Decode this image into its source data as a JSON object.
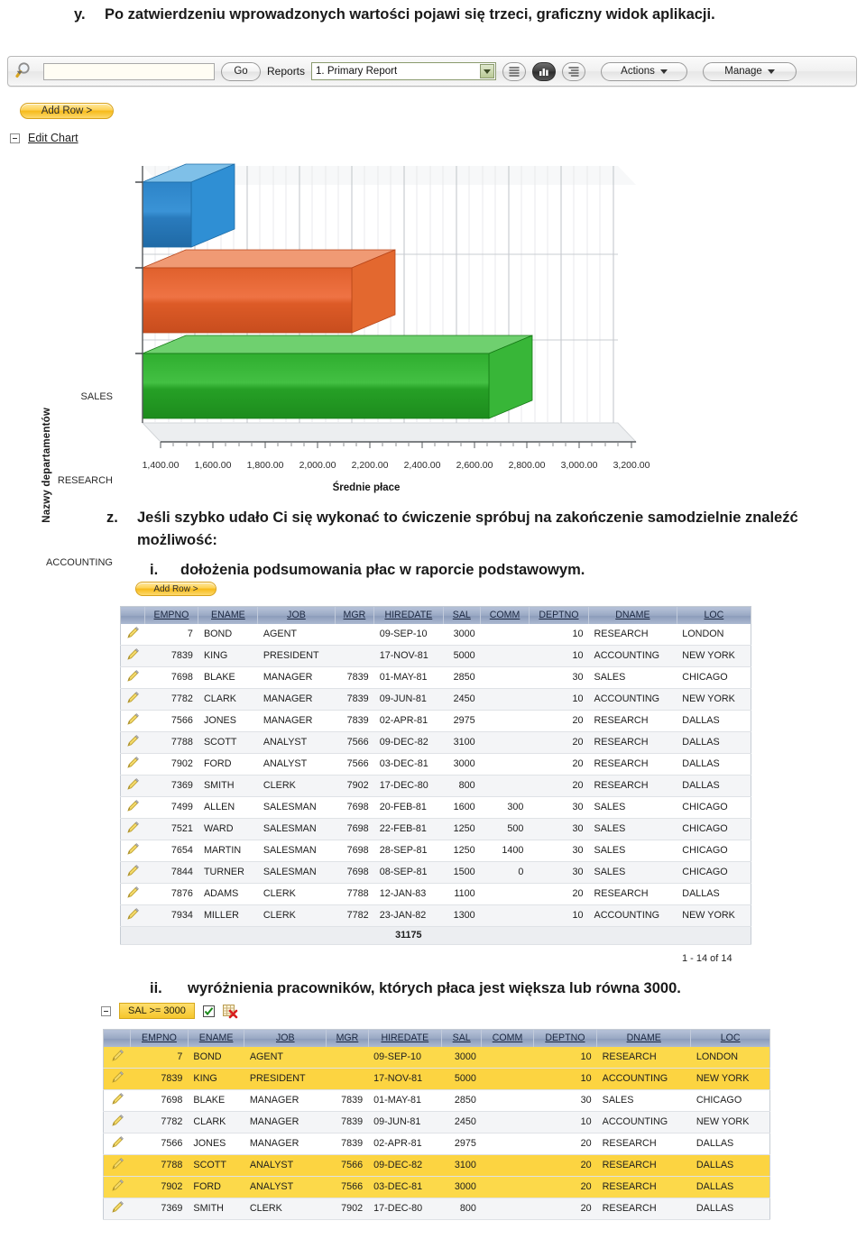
{
  "doc": {
    "para_y": {
      "marker": "y.",
      "text": "Po zatwierdzeniu wprowadzonych wartości pojawi się trzeci, graficzny widok aplikacji."
    },
    "para_z": {
      "marker": "z.",
      "text": "Jeśli szybko udało Ci się wykonać to ćwiczenie spróbuj na zakończenie samodzielnie znaleźć możliwość:"
    },
    "para_i": {
      "marker": "i.",
      "text": "dołożenia podsumowania płac w raporcie podstawowym."
    },
    "para_ii": {
      "marker": "ii.",
      "text": "wyróżnienia pracowników, których płaca jest większa lub równa 3000."
    }
  },
  "toolbar": {
    "search_value": "",
    "search_placeholder": "",
    "go_label": "Go",
    "reports_label": "Reports",
    "report_selected": "1. Primary Report",
    "view_report_icon": "report-view-icon",
    "view_chart_icon": "chart-view-icon",
    "view_group_icon": "group-by-view-icon",
    "actions_label": "Actions",
    "manage_label": "Manage"
  },
  "add_row_1": {
    "label": "Add Row >"
  },
  "add_row_2": {
    "label": "Add Row >"
  },
  "edit_chart": {
    "label": "Edit Chart"
  },
  "chart_data": {
    "type": "bar",
    "orientation": "horizontal",
    "title": "",
    "xlabel": "Średnie płace",
    "ylabel": "Nazwy departamentów",
    "categories": [
      "SALES",
      "RESEARCH",
      "ACCOUNTING"
    ],
    "values": [
      1566.67,
      2395.0,
      2916.67
    ],
    "series": [
      {
        "name": "Średnie płace",
        "values": [
          1566.67,
          2395.0,
          2916.67
        ]
      }
    ],
    "colors": [
      "#2a7fc0",
      "#df5c2a",
      "#2fb02f"
    ],
    "xlim": [
      1400,
      3200
    ],
    "xticks": [
      1400,
      1600,
      1800,
      2000,
      2200,
      2400,
      2600,
      2800,
      3000,
      3200
    ],
    "xtick_labels": [
      "1,400.00",
      "1,600.00",
      "1,800.00",
      "2,000.00",
      "2,200.00",
      "2,400.00",
      "2,600.00",
      "2,800.00",
      "3,000.00",
      "3,200.00"
    ],
    "grid": true,
    "legend": false
  },
  "report_table": {
    "columns": [
      "EMPNO",
      "ENAME",
      "JOB",
      "MGR",
      "HIREDATE",
      "SAL",
      "COMM",
      "DEPTNO",
      "DNAME",
      "LOC"
    ],
    "rows": [
      {
        "EMPNO": "7",
        "ENAME": "BOND",
        "JOB": "AGENT",
        "MGR": "",
        "HIREDATE": "09-SEP-10",
        "SAL": "3000",
        "COMM": "",
        "DEPTNO": "10",
        "DNAME": "RESEARCH",
        "LOC": "LONDON"
      },
      {
        "EMPNO": "7839",
        "ENAME": "KING",
        "JOB": "PRESIDENT",
        "MGR": "",
        "HIREDATE": "17-NOV-81",
        "SAL": "5000",
        "COMM": "",
        "DEPTNO": "10",
        "DNAME": "ACCOUNTING",
        "LOC": "NEW YORK"
      },
      {
        "EMPNO": "7698",
        "ENAME": "BLAKE",
        "JOB": "MANAGER",
        "MGR": "7839",
        "HIREDATE": "01-MAY-81",
        "SAL": "2850",
        "COMM": "",
        "DEPTNO": "30",
        "DNAME": "SALES",
        "LOC": "CHICAGO"
      },
      {
        "EMPNO": "7782",
        "ENAME": "CLARK",
        "JOB": "MANAGER",
        "MGR": "7839",
        "HIREDATE": "09-JUN-81",
        "SAL": "2450",
        "COMM": "",
        "DEPTNO": "10",
        "DNAME": "ACCOUNTING",
        "LOC": "NEW YORK"
      },
      {
        "EMPNO": "7566",
        "ENAME": "JONES",
        "JOB": "MANAGER",
        "MGR": "7839",
        "HIREDATE": "02-APR-81",
        "SAL": "2975",
        "COMM": "",
        "DEPTNO": "20",
        "DNAME": "RESEARCH",
        "LOC": "DALLAS"
      },
      {
        "EMPNO": "7788",
        "ENAME": "SCOTT",
        "JOB": "ANALYST",
        "MGR": "7566",
        "HIREDATE": "09-DEC-82",
        "SAL": "3100",
        "COMM": "",
        "DEPTNO": "20",
        "DNAME": "RESEARCH",
        "LOC": "DALLAS"
      },
      {
        "EMPNO": "7902",
        "ENAME": "FORD",
        "JOB": "ANALYST",
        "MGR": "7566",
        "HIREDATE": "03-DEC-81",
        "SAL": "3000",
        "COMM": "",
        "DEPTNO": "20",
        "DNAME": "RESEARCH",
        "LOC": "DALLAS"
      },
      {
        "EMPNO": "7369",
        "ENAME": "SMITH",
        "JOB": "CLERK",
        "MGR": "7902",
        "HIREDATE": "17-DEC-80",
        "SAL": "800",
        "COMM": "",
        "DEPTNO": "20",
        "DNAME": "RESEARCH",
        "LOC": "DALLAS"
      },
      {
        "EMPNO": "7499",
        "ENAME": "ALLEN",
        "JOB": "SALESMAN",
        "MGR": "7698",
        "HIREDATE": "20-FEB-81",
        "SAL": "1600",
        "COMM": "300",
        "DEPTNO": "30",
        "DNAME": "SALES",
        "LOC": "CHICAGO"
      },
      {
        "EMPNO": "7521",
        "ENAME": "WARD",
        "JOB": "SALESMAN",
        "MGR": "7698",
        "HIREDATE": "22-FEB-81",
        "SAL": "1250",
        "COMM": "500",
        "DEPTNO": "30",
        "DNAME": "SALES",
        "LOC": "CHICAGO"
      },
      {
        "EMPNO": "7654",
        "ENAME": "MARTIN",
        "JOB": "SALESMAN",
        "MGR": "7698",
        "HIREDATE": "28-SEP-81",
        "SAL": "1250",
        "COMM": "1400",
        "DEPTNO": "30",
        "DNAME": "SALES",
        "LOC": "CHICAGO"
      },
      {
        "EMPNO": "7844",
        "ENAME": "TURNER",
        "JOB": "SALESMAN",
        "MGR": "7698",
        "HIREDATE": "08-SEP-81",
        "SAL": "1500",
        "COMM": "0",
        "DEPTNO": "30",
        "DNAME": "SALES",
        "LOC": "CHICAGO"
      },
      {
        "EMPNO": "7876",
        "ENAME": "ADAMS",
        "JOB": "CLERK",
        "MGR": "7788",
        "HIREDATE": "12-JAN-83",
        "SAL": "1100",
        "COMM": "",
        "DEPTNO": "20",
        "DNAME": "RESEARCH",
        "LOC": "DALLAS"
      },
      {
        "EMPNO": "7934",
        "ENAME": "MILLER",
        "JOB": "CLERK",
        "MGR": "7782",
        "HIREDATE": "23-JAN-82",
        "SAL": "1300",
        "COMM": "",
        "DEPTNO": "10",
        "DNAME": "ACCOUNTING",
        "LOC": "NEW YORK"
      }
    ],
    "total_sal": "31175",
    "pagination": "1 - 14 of 14"
  },
  "filter": {
    "chip_label": "SAL >= 3000",
    "enabled": true,
    "checkbox_icon": "checkbox-checked-icon",
    "delete_icon": "delete-filter-icon"
  },
  "highlight_table": {
    "columns": [
      "EMPNO",
      "ENAME",
      "JOB",
      "MGR",
      "HIREDATE",
      "SAL",
      "COMM",
      "DEPTNO",
      "DNAME",
      "LOC"
    ],
    "rows": [
      {
        "EMPNO": "7",
        "ENAME": "BOND",
        "JOB": "AGENT",
        "MGR": "",
        "HIREDATE": "09-SEP-10",
        "SAL": "3000",
        "COMM": "",
        "DEPTNO": "10",
        "DNAME": "RESEARCH",
        "LOC": "LONDON",
        "highlight": true
      },
      {
        "EMPNO": "7839",
        "ENAME": "KING",
        "JOB": "PRESIDENT",
        "MGR": "",
        "HIREDATE": "17-NOV-81",
        "SAL": "5000",
        "COMM": "",
        "DEPTNO": "10",
        "DNAME": "ACCOUNTING",
        "LOC": "NEW YORK",
        "highlight": true
      },
      {
        "EMPNO": "7698",
        "ENAME": "BLAKE",
        "JOB": "MANAGER",
        "MGR": "7839",
        "HIREDATE": "01-MAY-81",
        "SAL": "2850",
        "COMM": "",
        "DEPTNO": "30",
        "DNAME": "SALES",
        "LOC": "CHICAGO",
        "highlight": false
      },
      {
        "EMPNO": "7782",
        "ENAME": "CLARK",
        "JOB": "MANAGER",
        "MGR": "7839",
        "HIREDATE": "09-JUN-81",
        "SAL": "2450",
        "COMM": "",
        "DEPTNO": "10",
        "DNAME": "ACCOUNTING",
        "LOC": "NEW YORK",
        "highlight": false
      },
      {
        "EMPNO": "7566",
        "ENAME": "JONES",
        "JOB": "MANAGER",
        "MGR": "7839",
        "HIREDATE": "02-APR-81",
        "SAL": "2975",
        "COMM": "",
        "DEPTNO": "20",
        "DNAME": "RESEARCH",
        "LOC": "DALLAS",
        "highlight": false
      },
      {
        "EMPNO": "7788",
        "ENAME": "SCOTT",
        "JOB": "ANALYST",
        "MGR": "7566",
        "HIREDATE": "09-DEC-82",
        "SAL": "3100",
        "COMM": "",
        "DEPTNO": "20",
        "DNAME": "RESEARCH",
        "LOC": "DALLAS",
        "highlight": true
      },
      {
        "EMPNO": "7902",
        "ENAME": "FORD",
        "JOB": "ANALYST",
        "MGR": "7566",
        "HIREDATE": "03-DEC-81",
        "SAL": "3000",
        "COMM": "",
        "DEPTNO": "20",
        "DNAME": "RESEARCH",
        "LOC": "DALLAS",
        "highlight": true
      },
      {
        "EMPNO": "7369",
        "ENAME": "SMITH",
        "JOB": "CLERK",
        "MGR": "7902",
        "HIREDATE": "17-DEC-80",
        "SAL": "800",
        "COMM": "",
        "DEPTNO": "20",
        "DNAME": "RESEARCH",
        "LOC": "DALLAS",
        "highlight": false
      }
    ]
  }
}
